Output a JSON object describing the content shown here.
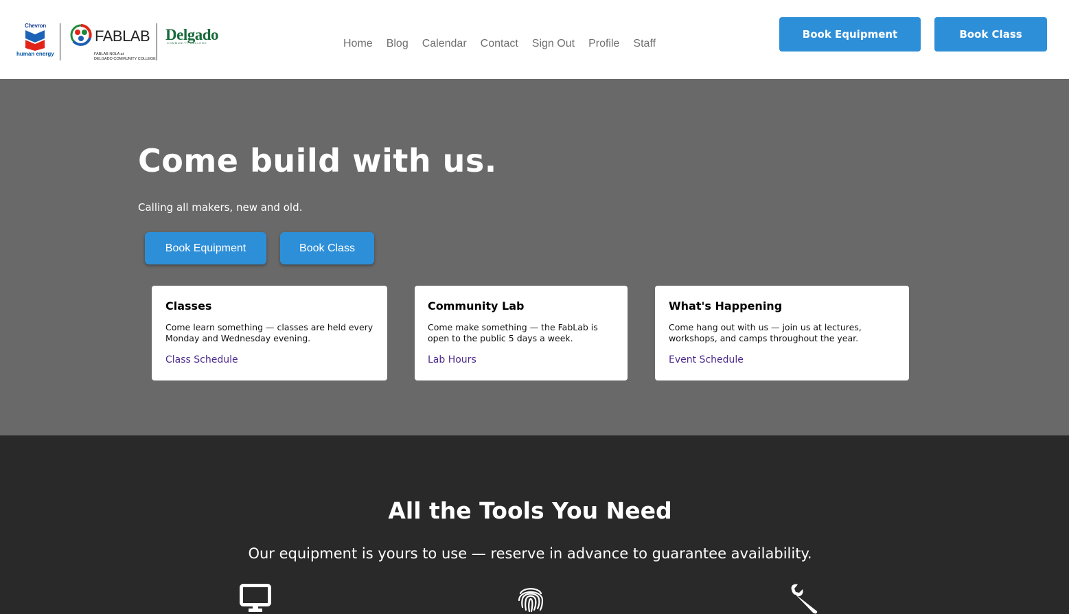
{
  "header": {
    "logos": {
      "chevron_brand": "Chevron",
      "chevron_tagline": "human energy",
      "fablab_brand": "FABLAB",
      "fablab_sub_line1": "FABLAB NOLA at",
      "fablab_sub_line2": "DELGADO COMMUNITY COLLEGE",
      "delgado_brand": "Delgado",
      "delgado_sub": "COMMUNITY COLLEGE"
    },
    "nav": [
      "Home",
      "Blog",
      "Calendar",
      "Contact",
      "Sign Out",
      "Profile",
      "Staff"
    ],
    "buttons": {
      "book_equipment": "Book Equipment",
      "book_class": "Book Class"
    }
  },
  "hero": {
    "title": "Come build with us.",
    "subtitle": "Calling all makers, new and old.",
    "buttons": {
      "book_equipment": "Book Equipment",
      "book_class": "Book Class"
    },
    "cards": [
      {
        "title": "Classes",
        "text": "Come learn something — classes are held every Monday and Wednesday evening.",
        "link": "Class Schedule"
      },
      {
        "title": "Community Lab",
        "text": "Come make something — the FabLab is open to the public 5 days a week.",
        "link": "Lab Hours"
      },
      {
        "title": "What's Happening",
        "text": "Come hang out with us — join us at lectures, workshops, and camps throughout the year.",
        "link": "Event Schedule"
      }
    ]
  },
  "tools": {
    "title": "All the Tools You Need",
    "subtitle": "Our equipment is yours to use — reserve in advance to guarantee availability.",
    "icons": [
      "monitor-icon",
      "fingerprint-icon",
      "wrench-icon"
    ]
  },
  "colors": {
    "accent_blue": "#2e8fd9",
    "hero_bg": "#696969",
    "tools_bg": "#292929",
    "link_purple": "#4b2a8c"
  }
}
